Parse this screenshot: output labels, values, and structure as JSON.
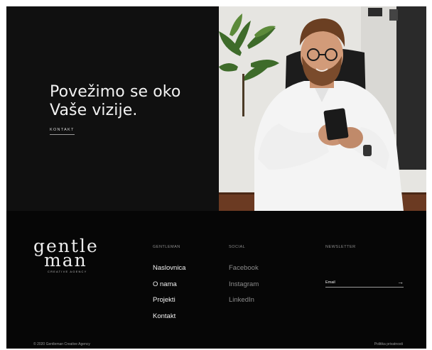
{
  "hero": {
    "title_line1": "Povežimo se oko",
    "title_line2": "Vaše vizije.",
    "cta_label": "KONTAKT"
  },
  "footer": {
    "logo": {
      "line1": "gentle",
      "line2": "man",
      "tagline": "CREATIVE AGENCY"
    },
    "columns": {
      "gentleman": {
        "heading": "GENTLEMAN",
        "items": [
          "Naslovnica",
          "O nama",
          "Projekti",
          "Kontakt"
        ]
      },
      "social": {
        "heading": "SOCIAL",
        "items": [
          "Facebook",
          "Instagram",
          "LinkedIn"
        ]
      },
      "newsletter": {
        "heading": "NEWSLETTER",
        "placeholder": "Email",
        "submit_icon": "arrow-right-icon"
      }
    },
    "copyright": "© 2020 Gentleman Creative Agency",
    "privacy_label": "Politika privatnosti"
  },
  "colors": {
    "background": "#070707",
    "hero_panel": "#101010",
    "text_primary": "#f0f0f0",
    "text_muted": "#8e8e8e"
  }
}
